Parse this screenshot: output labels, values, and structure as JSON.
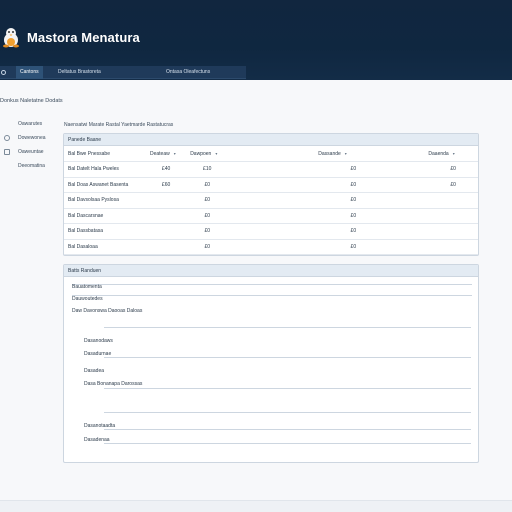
{
  "app": {
    "title": "Mastora Menatura"
  },
  "nav": {
    "items": [
      {
        "label": "Cantons"
      },
      {
        "label": "Deltatus Brastoreta"
      },
      {
        "label": "Ontasa Oleafectuns"
      }
    ]
  },
  "page": {
    "title": "Donkus Naletatne Dodats"
  },
  "sidebar": {
    "items": [
      {
        "label": "Oawarutes"
      },
      {
        "label": "Dowewonea"
      },
      {
        "label": "Oaweuntae"
      },
      {
        "label": "Deeomatina"
      }
    ]
  },
  "filter": {
    "text": "Naensatwi Marate Rastal Yaetmarde Rastatucras"
  },
  "table": {
    "panel_title": "Panede Baane",
    "columns": [
      "Bal Bwe Pnessabe",
      "Deateaw",
      "Dawpoen",
      "Dassande",
      "Daaenda"
    ],
    "rows": [
      {
        "c1": "Bal Datelt Hala",
        "c2": "Pweles",
        "c3": "£40",
        "c4": "£10",
        "c5": "£0",
        "c6": "£0"
      },
      {
        "c1": "Bal Doas Aswanet",
        "c2": "Basenta",
        "c3": "£60",
        "c4": "£0",
        "c5": "£0",
        "c6": "£0"
      },
      {
        "c1": "Bal Davsolsaa Pyslosa",
        "c2": "",
        "c3": "",
        "c4": "£0",
        "c5": "£0",
        "c6": ""
      },
      {
        "c1": "Bal Dascarsnae",
        "c2": "",
        "c3": "",
        "c4": "£0",
        "c5": "£0",
        "c6": ""
      },
      {
        "c1": "Bal Dassbatasa",
        "c2": "",
        "c3": "",
        "c4": "£0",
        "c5": "£0",
        "c6": ""
      },
      {
        "c1": "Bal Dasaloaa",
        "c2": "",
        "c3": "",
        "c4": "£0",
        "c5": "£0",
        "c6": ""
      }
    ]
  },
  "form": {
    "panel_title": "Batts Randuen",
    "rows": [
      {
        "label": "Bauatomenta"
      },
      {
        "label": "Dauwoutedes"
      },
      {
        "label": "Daw Davonswa Daooas Daloas"
      },
      {
        "label": "Dasanodaws"
      },
      {
        "label": "Dasadurnae"
      },
      {
        "label": "Dasadea"
      },
      {
        "label": "Dasa Bonanapa Darossas"
      },
      {
        "label": "Dasanotaadta"
      },
      {
        "label": "Dasadenaa"
      }
    ]
  }
}
